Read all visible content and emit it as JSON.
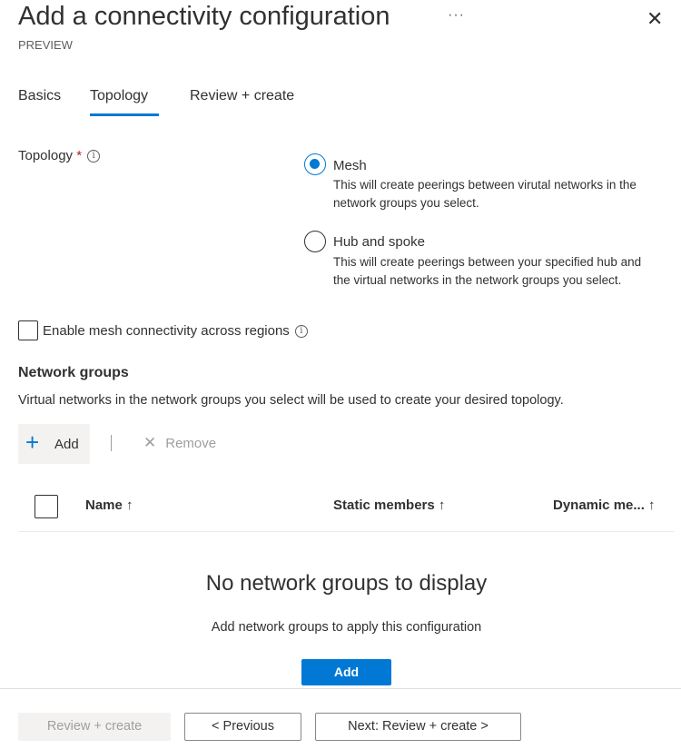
{
  "header": {
    "title": "Add a connectivity configuration",
    "subtitle": "PREVIEW",
    "more": "···",
    "close": "✕"
  },
  "tabs": [
    {
      "label": "Basics"
    },
    {
      "label": "Topology",
      "active": true
    },
    {
      "label": "Review + create"
    }
  ],
  "topology": {
    "label": "Topology",
    "required": "*",
    "info": "i",
    "options": [
      {
        "label": "Mesh",
        "description": "This will create peerings between virutal networks in the network groups you select.",
        "selected": true
      },
      {
        "label": "Hub and spoke",
        "description": "This will create peerings between your specified hub and the virtual networks in the network groups you select.",
        "selected": false
      }
    ]
  },
  "mesh_across_regions": {
    "label": "Enable mesh connectivity across regions",
    "checked": false,
    "info": "i"
  },
  "network_groups": {
    "heading": "Network groups",
    "description": "Virtual networks in the network groups you select will be used to create your desired topology.",
    "toolbar": {
      "add": "Add",
      "remove": "Remove"
    },
    "columns": [
      "Name ↑",
      "Static members ↑",
      "Dynamic me... ↑"
    ],
    "empty_title": "No network groups to display",
    "empty_description": "Add network groups to apply this configuration",
    "empty_add": "Add"
  },
  "footer": {
    "review_create": "Review + create",
    "previous": "< Previous",
    "next": "Next: Review + create >"
  },
  "colors": {
    "accent": "#0078d4",
    "required": "#a4262c"
  }
}
